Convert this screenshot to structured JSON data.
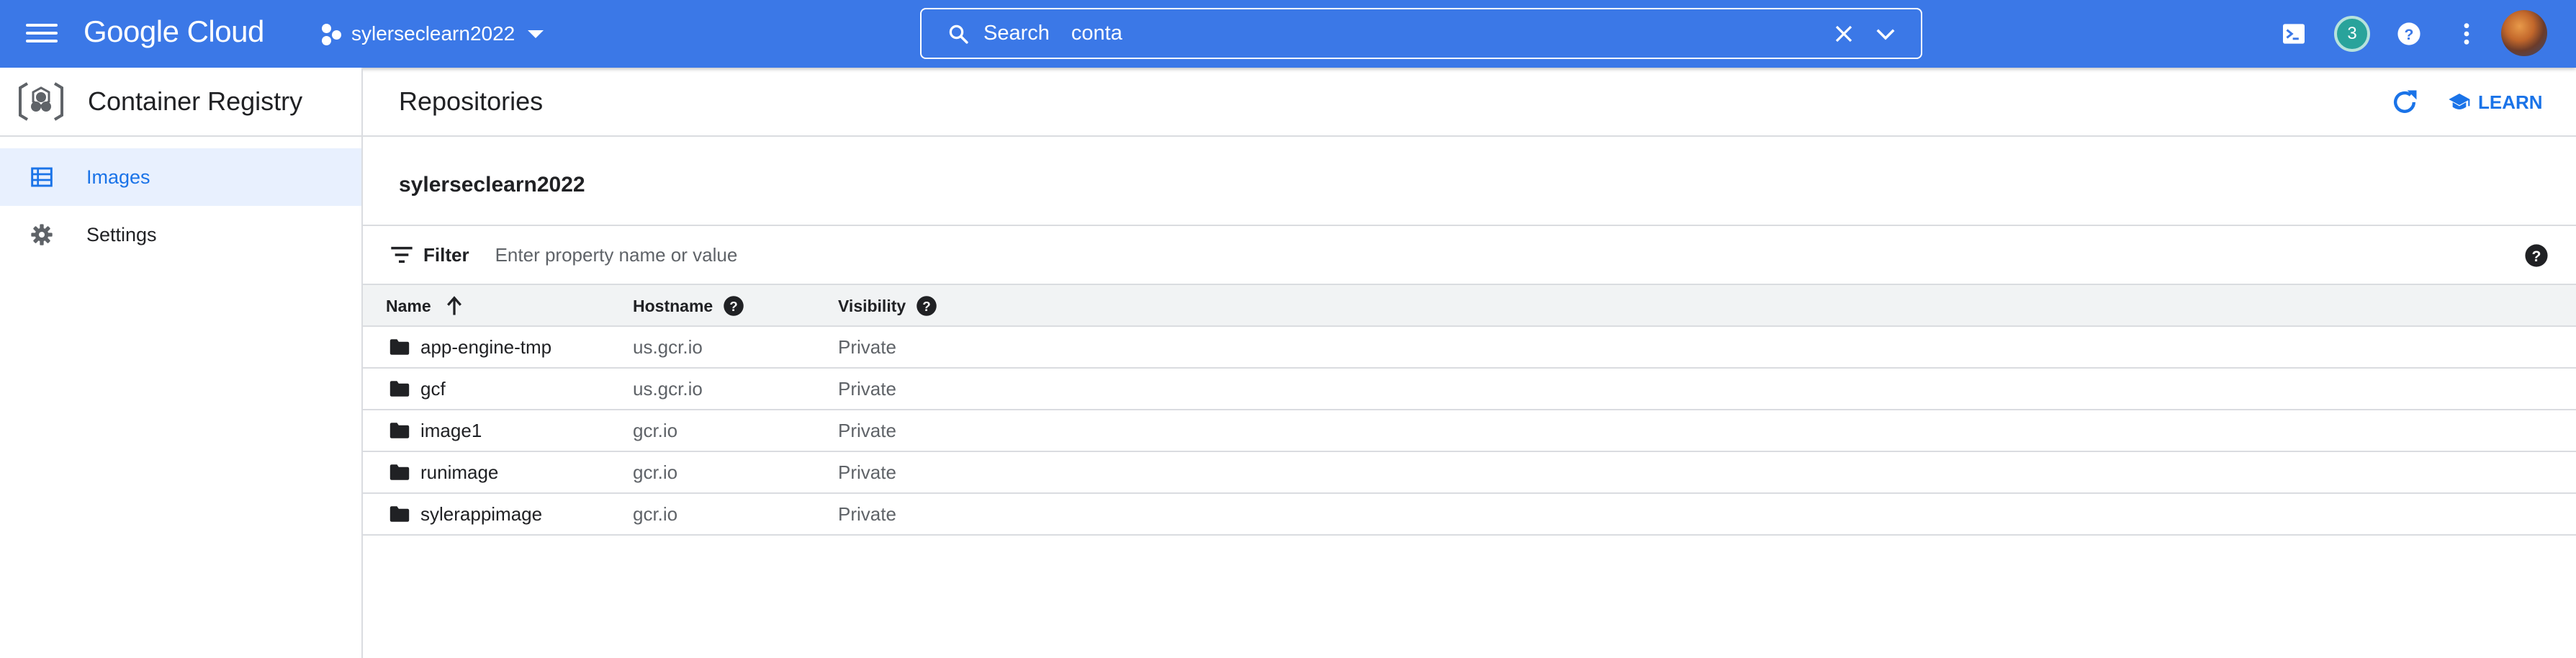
{
  "topbar": {
    "logo": "Google Cloud",
    "project_name": "sylerseclearn2022",
    "search_label": "Search",
    "search_query": "conta",
    "notification_count": "3",
    "colors": {
      "bar": "#3b78e7",
      "badge": "#29a39b"
    },
    "icons": [
      "menu-icon",
      "project-icon",
      "search-icon",
      "close-icon",
      "chevron-down-icon",
      "cloud-shell-icon",
      "help-icon",
      "more-vert-icon"
    ]
  },
  "sidenav": {
    "product_title": "Container Registry",
    "items": [
      {
        "label": "Images",
        "icon": "list-icon",
        "active": true
      },
      {
        "label": "Settings",
        "icon": "gear-icon",
        "active": false
      }
    ]
  },
  "main": {
    "title": "Repositories",
    "learn_label": "LEARN",
    "repository": "sylerseclearn2022",
    "filter_label": "Filter",
    "filter_placeholder": "Enter property name or value",
    "columns": [
      "Name",
      "Hostname",
      "Visibility"
    ],
    "sort": {
      "column": "Name",
      "direction": "ascending"
    },
    "rows": [
      {
        "name": "app-engine-tmp",
        "hostname": "us.gcr.io",
        "visibility": "Private"
      },
      {
        "name": "gcf",
        "hostname": "us.gcr.io",
        "visibility": "Private"
      },
      {
        "name": "image1",
        "hostname": "gcr.io",
        "visibility": "Private"
      },
      {
        "name": "runimage",
        "hostname": "gcr.io",
        "visibility": "Private"
      },
      {
        "name": "sylerappimage",
        "hostname": "gcr.io",
        "visibility": "Private"
      }
    ]
  }
}
